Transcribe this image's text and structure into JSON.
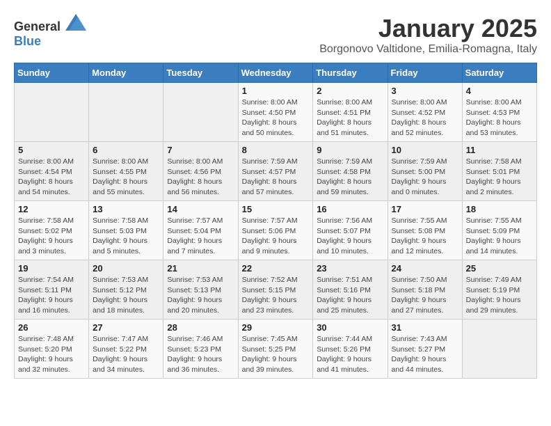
{
  "header": {
    "logo_general": "General",
    "logo_blue": "Blue",
    "month_title": "January 2025",
    "subtitle": "Borgonovo Valtidone, Emilia-Romagna, Italy"
  },
  "weekdays": [
    "Sunday",
    "Monday",
    "Tuesday",
    "Wednesday",
    "Thursday",
    "Friday",
    "Saturday"
  ],
  "weeks": [
    [
      {
        "day": "",
        "info": ""
      },
      {
        "day": "",
        "info": ""
      },
      {
        "day": "",
        "info": ""
      },
      {
        "day": "1",
        "info": "Sunrise: 8:00 AM\nSunset: 4:50 PM\nDaylight: 8 hours and 50 minutes."
      },
      {
        "day": "2",
        "info": "Sunrise: 8:00 AM\nSunset: 4:51 PM\nDaylight: 8 hours and 51 minutes."
      },
      {
        "day": "3",
        "info": "Sunrise: 8:00 AM\nSunset: 4:52 PM\nDaylight: 8 hours and 52 minutes."
      },
      {
        "day": "4",
        "info": "Sunrise: 8:00 AM\nSunset: 4:53 PM\nDaylight: 8 hours and 53 minutes."
      }
    ],
    [
      {
        "day": "5",
        "info": "Sunrise: 8:00 AM\nSunset: 4:54 PM\nDaylight: 8 hours and 54 minutes."
      },
      {
        "day": "6",
        "info": "Sunrise: 8:00 AM\nSunset: 4:55 PM\nDaylight: 8 hours and 55 minutes."
      },
      {
        "day": "7",
        "info": "Sunrise: 8:00 AM\nSunset: 4:56 PM\nDaylight: 8 hours and 56 minutes."
      },
      {
        "day": "8",
        "info": "Sunrise: 7:59 AM\nSunset: 4:57 PM\nDaylight: 8 hours and 57 minutes."
      },
      {
        "day": "9",
        "info": "Sunrise: 7:59 AM\nSunset: 4:58 PM\nDaylight: 8 hours and 59 minutes."
      },
      {
        "day": "10",
        "info": "Sunrise: 7:59 AM\nSunset: 5:00 PM\nDaylight: 9 hours and 0 minutes."
      },
      {
        "day": "11",
        "info": "Sunrise: 7:58 AM\nSunset: 5:01 PM\nDaylight: 9 hours and 2 minutes."
      }
    ],
    [
      {
        "day": "12",
        "info": "Sunrise: 7:58 AM\nSunset: 5:02 PM\nDaylight: 9 hours and 3 minutes."
      },
      {
        "day": "13",
        "info": "Sunrise: 7:58 AM\nSunset: 5:03 PM\nDaylight: 9 hours and 5 minutes."
      },
      {
        "day": "14",
        "info": "Sunrise: 7:57 AM\nSunset: 5:04 PM\nDaylight: 9 hours and 7 minutes."
      },
      {
        "day": "15",
        "info": "Sunrise: 7:57 AM\nSunset: 5:06 PM\nDaylight: 9 hours and 9 minutes."
      },
      {
        "day": "16",
        "info": "Sunrise: 7:56 AM\nSunset: 5:07 PM\nDaylight: 9 hours and 10 minutes."
      },
      {
        "day": "17",
        "info": "Sunrise: 7:55 AM\nSunset: 5:08 PM\nDaylight: 9 hours and 12 minutes."
      },
      {
        "day": "18",
        "info": "Sunrise: 7:55 AM\nSunset: 5:09 PM\nDaylight: 9 hours and 14 minutes."
      }
    ],
    [
      {
        "day": "19",
        "info": "Sunrise: 7:54 AM\nSunset: 5:11 PM\nDaylight: 9 hours and 16 minutes."
      },
      {
        "day": "20",
        "info": "Sunrise: 7:53 AM\nSunset: 5:12 PM\nDaylight: 9 hours and 18 minutes."
      },
      {
        "day": "21",
        "info": "Sunrise: 7:53 AM\nSunset: 5:13 PM\nDaylight: 9 hours and 20 minutes."
      },
      {
        "day": "22",
        "info": "Sunrise: 7:52 AM\nSunset: 5:15 PM\nDaylight: 9 hours and 23 minutes."
      },
      {
        "day": "23",
        "info": "Sunrise: 7:51 AM\nSunset: 5:16 PM\nDaylight: 9 hours and 25 minutes."
      },
      {
        "day": "24",
        "info": "Sunrise: 7:50 AM\nSunset: 5:18 PM\nDaylight: 9 hours and 27 minutes."
      },
      {
        "day": "25",
        "info": "Sunrise: 7:49 AM\nSunset: 5:19 PM\nDaylight: 9 hours and 29 minutes."
      }
    ],
    [
      {
        "day": "26",
        "info": "Sunrise: 7:48 AM\nSunset: 5:20 PM\nDaylight: 9 hours and 32 minutes."
      },
      {
        "day": "27",
        "info": "Sunrise: 7:47 AM\nSunset: 5:22 PM\nDaylight: 9 hours and 34 minutes."
      },
      {
        "day": "28",
        "info": "Sunrise: 7:46 AM\nSunset: 5:23 PM\nDaylight: 9 hours and 36 minutes."
      },
      {
        "day": "29",
        "info": "Sunrise: 7:45 AM\nSunset: 5:25 PM\nDaylight: 9 hours and 39 minutes."
      },
      {
        "day": "30",
        "info": "Sunrise: 7:44 AM\nSunset: 5:26 PM\nDaylight: 9 hours and 41 minutes."
      },
      {
        "day": "31",
        "info": "Sunrise: 7:43 AM\nSunset: 5:27 PM\nDaylight: 9 hours and 44 minutes."
      },
      {
        "day": "",
        "info": ""
      }
    ]
  ]
}
